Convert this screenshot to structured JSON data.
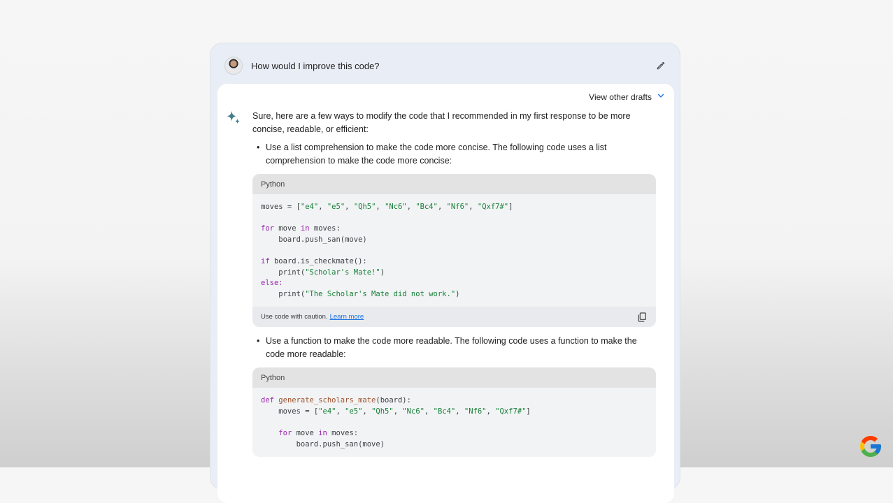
{
  "prompt": {
    "text": "How would I improve this code?"
  },
  "drafts": {
    "label": "View other drafts"
  },
  "response": {
    "intro": "Sure, here are a few ways to modify the code that I recommended in my first response to be more concise, readable, or efficient:",
    "bullet1": "Use a list comprehension to make the code more concise. The following code uses a list comprehension to make the code more concise:",
    "bullet2": "Use a function to make the code more readable. The following code uses a function to make the code more readable:"
  },
  "code1": {
    "language": "Python",
    "line1_a": "moves = [",
    "moves": [
      "\"e4\"",
      "\"e5\"",
      "\"Qh5\"",
      "\"Nc6\"",
      "\"Bc4\"",
      "\"Nf6\"",
      "\"Qxf7#\""
    ],
    "line_for_kw": "for",
    "line_for_mid": " move ",
    "line_in_kw": "in",
    "line_for_end": " moves:",
    "line_push": "    board.push_san(move)",
    "line_if_kw": "if",
    "line_if_rest": " board.is_checkmate():",
    "line_print1_a": "    print(",
    "line_print1_str": "\"Scholar's Mate!\"",
    "line_print1_b": ")",
    "line_else_kw": "else:",
    "line_print2_a": "    print(",
    "line_print2_str": "\"The Scholar's Mate did not work.\"",
    "line_print2_b": ")",
    "footer_text": "Use code with caution.",
    "footer_link": "Learn more"
  },
  "code2": {
    "language": "Python",
    "def_kw": "def",
    "fn_name": "generate_scholars_mate",
    "def_rest": "(board):",
    "line2_a": "    moves = [",
    "moves": [
      "\"e4\"",
      "\"e5\"",
      "\"Qh5\"",
      "\"Nc6\"",
      "\"Bc4\"",
      "\"Nf6\"",
      "\"Qxf7#\""
    ],
    "for_indent": "    ",
    "for_kw": "for",
    "for_mid": " move ",
    "in_kw": "in",
    "for_end": " moves:",
    "push": "        board.push_san(move)"
  },
  "colors": {
    "accent": "#1a73e8",
    "keyword": "#9c27b0",
    "string": "#188038"
  },
  "icons": {
    "edit": "pencil-icon",
    "drafts": "chevron-down-icon",
    "assistant": "sparkle-icon",
    "copy": "copy-icon",
    "brand": "google-g-logo-icon"
  }
}
